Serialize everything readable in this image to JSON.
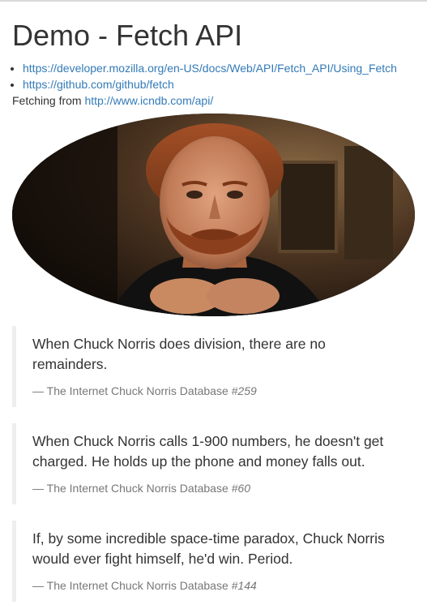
{
  "page": {
    "title": "Demo - Fetch API",
    "links": [
      "https://developer.mozilla.org/en-US/docs/Web/API/Fetch_API/Using_Fetch",
      "https://github.com/github/fetch"
    ],
    "fetching_prefix": "Fetching from",
    "fetching_url": "http://www.icndb.com/api/"
  },
  "photo": {
    "subject": "portrait-photo"
  },
  "quotes": [
    {
      "text": "When Chuck Norris does division, there are no remainders.",
      "source": "— The Internet Chuck Norris Database",
      "id": "#259"
    },
    {
      "text": "When Chuck Norris calls 1-900 numbers, he doesn't get charged. He holds up the phone and money falls out.",
      "source": "— The Internet Chuck Norris Database",
      "id": "#60"
    },
    {
      "text": "If, by some incredible space-time paradox, Chuck Norris would ever fight himself, he'd win. Period.",
      "source": "— The Internet Chuck Norris Database",
      "id": "#144"
    }
  ],
  "colors": {
    "link": "#337ab7",
    "text": "#333333",
    "muted": "#777777",
    "quote_border": "#eeeeee"
  }
}
